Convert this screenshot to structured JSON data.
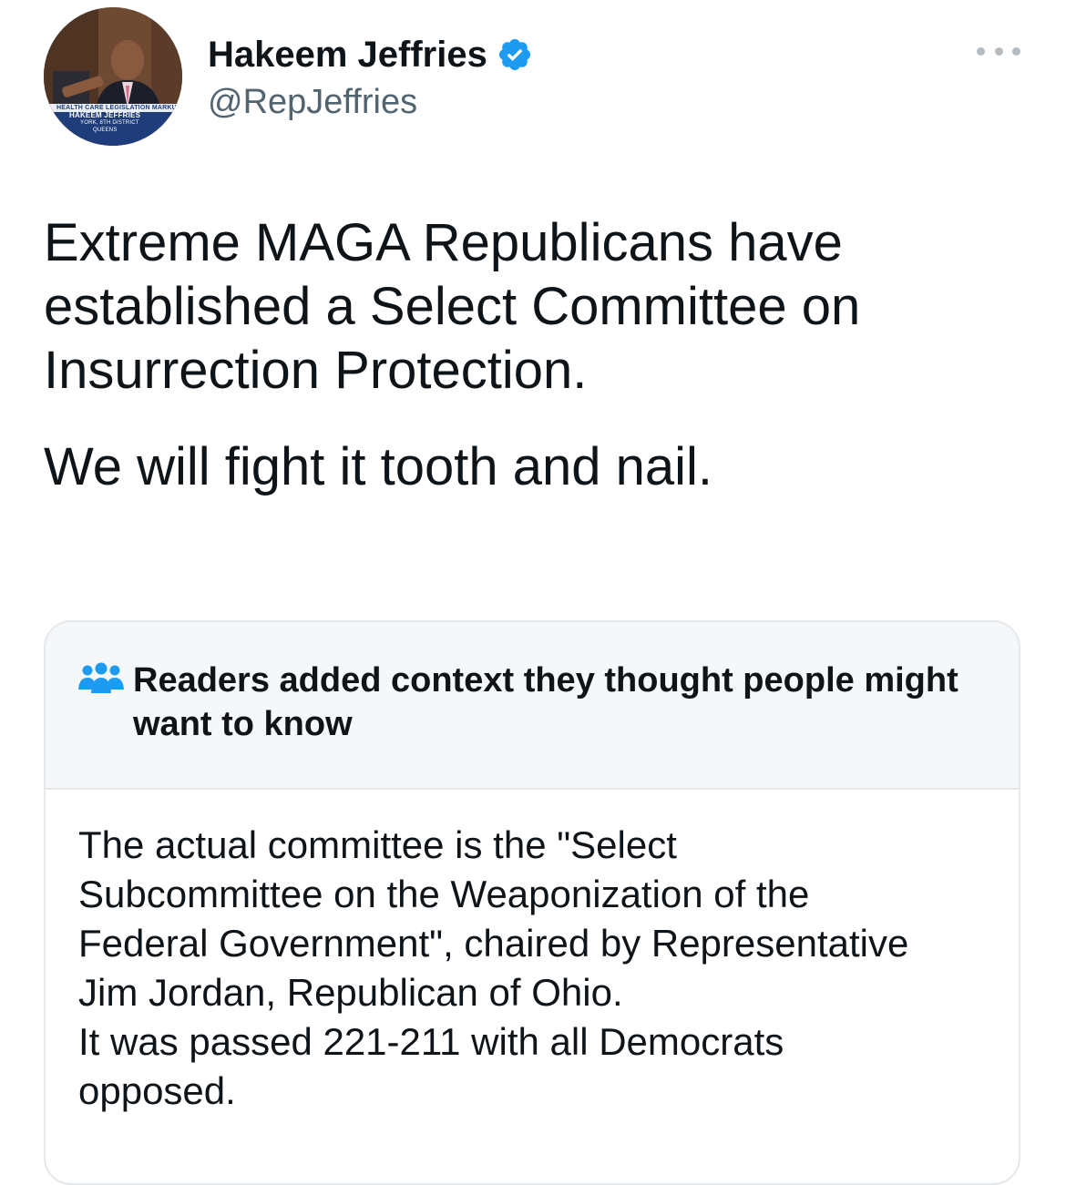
{
  "author": {
    "display_name": "Hakeem Jeffries",
    "handle": "@RepJeffries",
    "verified": true,
    "avatar_caption": [
      "Health Care Legislation Markup",
      "Hakeem Jeffries",
      "York, 8th District",
      "Queens"
    ]
  },
  "tweet": {
    "paragraphs": [
      "Extreme MAGA Republicans have established a Select Committee on Insurrection Protection.",
      "We will fight it tooth and nail."
    ]
  },
  "community_note": {
    "title": "Readers added context they thought people might want to know",
    "body_lines": [
      "The actual committee is the \"Select",
      "Subcommittee on the Weaponization of the",
      "Federal Government\", chaired by Representative",
      "Jim Jordan, Republican of Ohio.",
      "It was passed 221-211 with all Democrats",
      "opposed."
    ]
  },
  "icons": {
    "verified": "verified-badge-icon",
    "more": "more-options-icon",
    "note": "people-group-icon"
  },
  "colors": {
    "accent": "#1d9bf0",
    "text": "#0f1419",
    "secondary_text": "#536471",
    "note_header_bg": "#f5f7f8",
    "border": "#e4e8eb"
  }
}
